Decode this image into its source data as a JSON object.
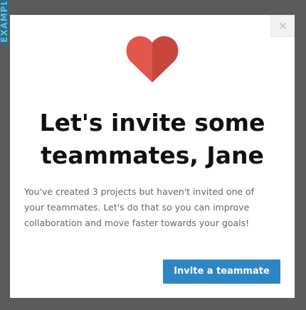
{
  "background": {
    "side_tab_text": "EXAMPLES",
    "side_tab_color": "#1e6e93",
    "overlay_color": "#5a5b5d"
  },
  "modal": {
    "close_label": "×",
    "icon": "heart-icon",
    "heart_colors": {
      "left": "#e2574c",
      "right": "#c7473c"
    },
    "title_line1": "Let's invite some",
    "title_line2": "teammates, Jane",
    "message_line1": "You've created 3 projects but haven't invited one of",
    "message_line2": "your teammates. Let's do that so you can improve",
    "message_line3": "collaboration and move faster towards your goals!",
    "invite_button_label": "Invite a teammate",
    "accent_color": "#2d86c3"
  }
}
